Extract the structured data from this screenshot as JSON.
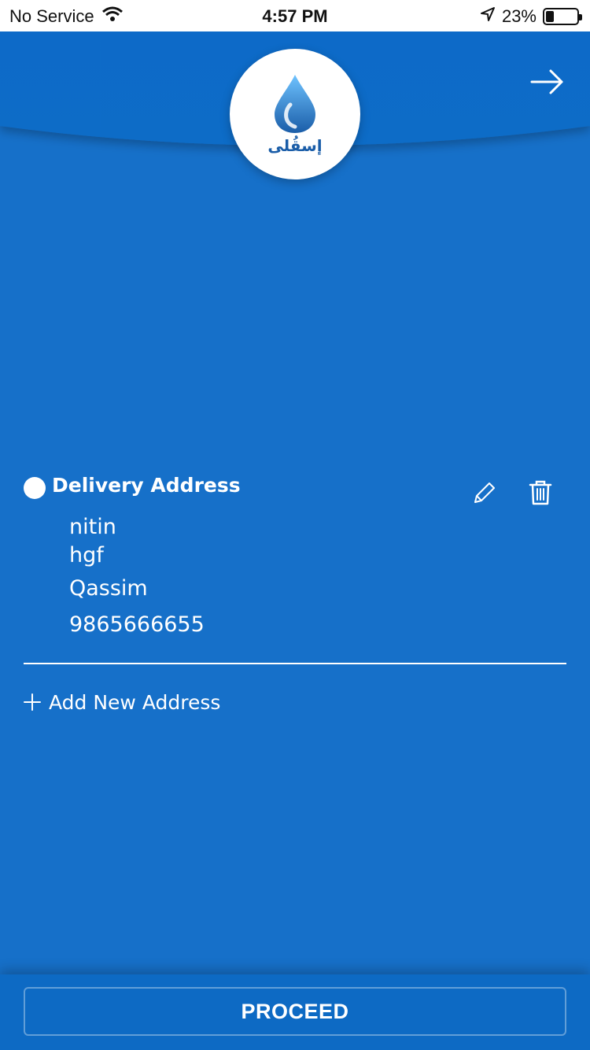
{
  "status_bar": {
    "carrier": "No Service",
    "time": "4:57 PM",
    "battery": "23%",
    "icons": [
      "wifi-icon",
      "location-arrow-icon",
      "battery-icon"
    ]
  },
  "header": {
    "logo_text": "إسقُلى",
    "forward_icon": "arrow-right-icon"
  },
  "address": {
    "title": "Delivery Address",
    "name": "nitin",
    "line1": "hgf",
    "city": "Qassim",
    "phone": "9865666655",
    "edit_icon": "pencil-icon",
    "delete_icon": "trash-icon"
  },
  "add_new": {
    "label": "Add New Address",
    "icon": "plus-icon"
  },
  "footer": {
    "proceed_label": "PROCEED"
  },
  "colors": {
    "background": "#1670c9",
    "header": "#0a6cc8",
    "white": "#ffffff"
  }
}
